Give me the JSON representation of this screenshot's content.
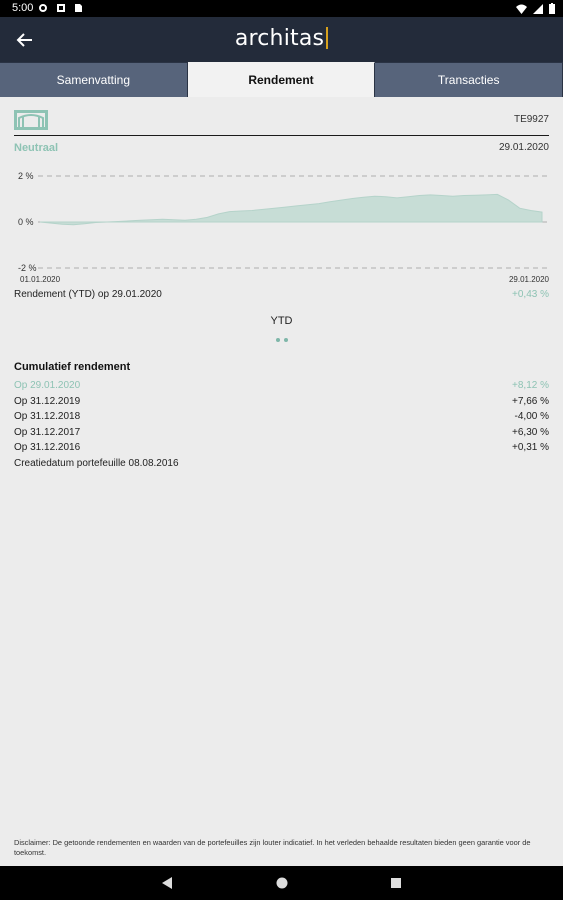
{
  "status_bar": {
    "time": "5:00"
  },
  "app_bar": {
    "brand": "architas"
  },
  "tabs": [
    {
      "label": "Samenvatting",
      "active": false
    },
    {
      "label": "Rendement",
      "active": true
    },
    {
      "label": "Transacties",
      "active": false
    }
  ],
  "portfolio": {
    "code": "TE9927",
    "profile": "Neutraal",
    "date": "29.01.2020"
  },
  "chart_data": {
    "type": "area",
    "x_start_label": "01.01.2020",
    "x_end_label": "29.01.2020",
    "y_tick_labels": [
      "2 %",
      "0 %",
      "-2 %"
    ],
    "ylim": [
      -2,
      2
    ],
    "grid": "dashed horizontal",
    "color": "#c7ddd6",
    "values": [
      0.0,
      -0.05,
      -0.1,
      -0.12,
      -0.08,
      -0.02,
      0.0,
      0.02,
      0.05,
      0.08,
      0.1,
      0.12,
      0.1,
      0.08,
      0.12,
      0.2,
      0.35,
      0.45,
      0.48,
      0.5,
      0.55,
      0.6,
      0.65,
      0.7,
      0.75,
      0.8,
      0.88,
      0.95,
      1.02,
      1.08,
      1.12,
      1.1,
      1.05,
      1.1,
      1.15,
      1.18,
      1.15,
      1.12,
      1.15,
      1.16,
      1.18,
      1.2,
      0.95,
      0.6,
      0.5,
      0.43
    ]
  },
  "ytd": {
    "label": "Rendement (YTD) op 29.01.2020",
    "value": "+0,43 %"
  },
  "period": {
    "label": "YTD"
  },
  "cumulative": {
    "title": "Cumulatief rendement",
    "rows": [
      {
        "label": "Op 29.01.2020",
        "value": "+8,12 %"
      },
      {
        "label": "Op 31.12.2019",
        "value": "+7,66 %"
      },
      {
        "label": "Op 31.12.2018",
        "value": "-4,00 %"
      },
      {
        "label": "Op 31.12.2017",
        "value": "+6,30 %"
      },
      {
        "label": "Op 31.12.2016",
        "value": "+0,31 %"
      }
    ],
    "created": "Creatiedatum portefeuille 08.08.2016"
  },
  "disclaimer": "Disclaimer: De getoonde rendementen en waarden van de portefeuilles zijn louter indicatief. In het verleden behaalde resultaten bieden geen garantie voor de toekomst.",
  "colors": {
    "accent": "#8ec3b4",
    "appbar": "#232b3a",
    "tabs": "#57647b",
    "brand_bar": "#d7a11d"
  }
}
